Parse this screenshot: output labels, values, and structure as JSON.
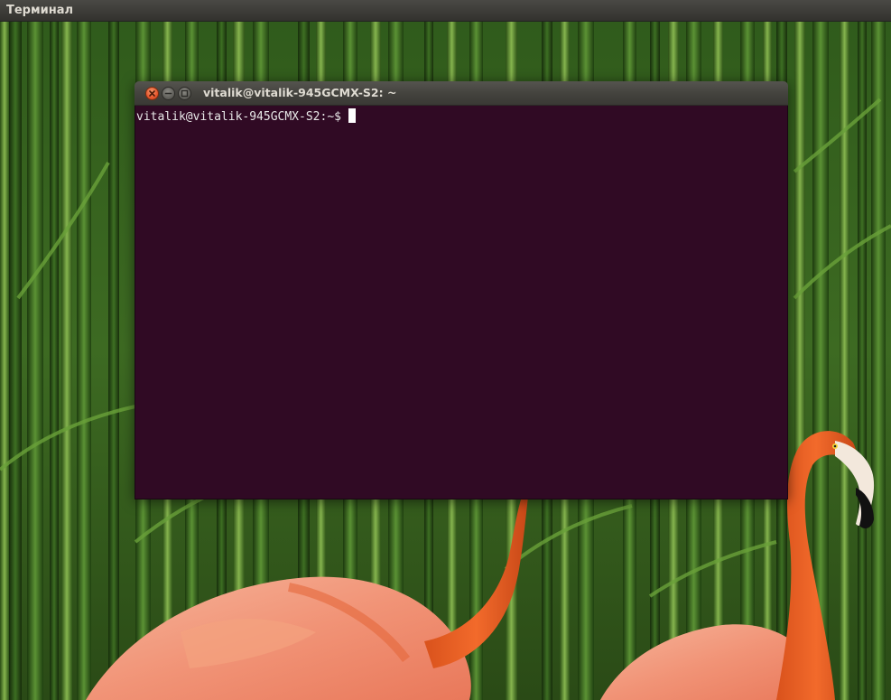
{
  "panel": {
    "app_title": "Терминал"
  },
  "window": {
    "title": "vitalik@vitalik-945GCMX-S2: ~",
    "buttons": {
      "close_icon": "close-icon",
      "minimize_icon": "minimize-icon",
      "maximize_icon": "maximize-icon"
    }
  },
  "terminal": {
    "prompt": "vitalik@vitalik-945GCMX-S2:~$",
    "background_color": "#300a24",
    "text_color": "#e8e8e8"
  },
  "colors": {
    "panel": "#3c3b37",
    "close_button": "#e5562d",
    "terminal_background": "#300a24"
  }
}
